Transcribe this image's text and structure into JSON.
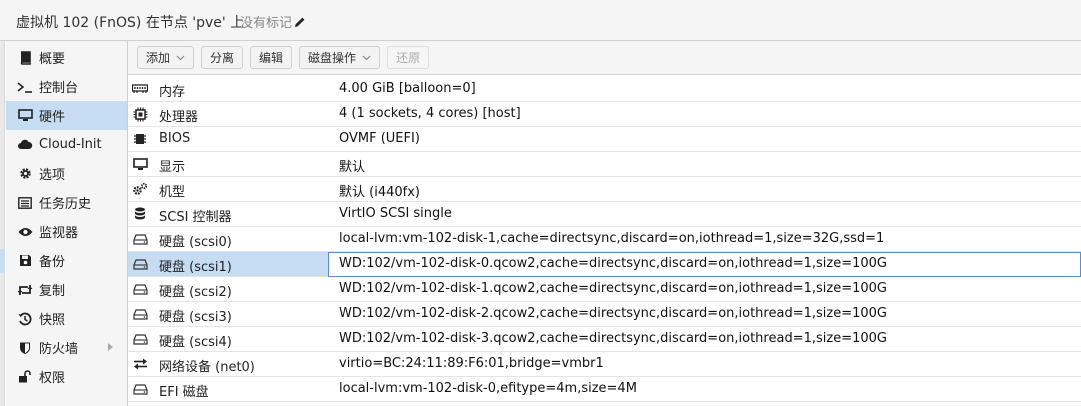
{
  "header": {
    "title": "虚拟机 102 (FnOS) 在节点 'pve' 上",
    "tags": "没有标记"
  },
  "sidebar": {
    "items": [
      {
        "label": "概要",
        "icon": "book-icon"
      },
      {
        "label": "控制台",
        "icon": "terminal-icon"
      },
      {
        "label": "硬件",
        "icon": "monitor-icon",
        "active": true
      },
      {
        "label": "Cloud-Init",
        "icon": "cloud-icon"
      },
      {
        "label": "选项",
        "icon": "gear-icon"
      },
      {
        "label": "任务历史",
        "icon": "list-icon"
      },
      {
        "label": "监视器",
        "icon": "eye-icon"
      },
      {
        "label": "备份",
        "icon": "floppy-icon"
      },
      {
        "label": "复制",
        "icon": "retweet-icon"
      },
      {
        "label": "快照",
        "icon": "history-icon"
      },
      {
        "label": "防火墙",
        "icon": "shield-icon"
      },
      {
        "label": "权限",
        "icon": "unlock-icon"
      }
    ]
  },
  "toolbar": {
    "add_label": "添加",
    "detach_label": "分离",
    "edit_label": "编辑",
    "disk_action_label": "磁盘操作",
    "revert_label": "还原"
  },
  "hardware": {
    "rows": [
      {
        "icon": "memory-icon",
        "name": "内存",
        "value": "4.00 GiB [balloon=0]"
      },
      {
        "icon": "cpu-icon",
        "name": "处理器",
        "value": "4 (1 sockets, 4 cores) [host]"
      },
      {
        "icon": "chip-icon",
        "name": "BIOS",
        "value": "OVMF (UEFI)"
      },
      {
        "icon": "display-icon",
        "name": "显示",
        "value": "默认"
      },
      {
        "icon": "cogs-icon",
        "name": "机型",
        "value": "默认 (i440fx)"
      },
      {
        "icon": "database-icon",
        "name": "SCSI 控制器",
        "value": "VirtIO SCSI single"
      },
      {
        "icon": "hdd-icon",
        "name": "硬盘 (scsi0)",
        "value": "local-lvm:vm-102-disk-1,cache=directsync,discard=on,iothread=1,size=32G,ssd=1"
      },
      {
        "icon": "hdd-icon",
        "name": "硬盘 (scsi1)",
        "value": "WD:102/vm-102-disk-0.qcow2,cache=directsync,discard=on,iothread=1,size=100G",
        "selected": true
      },
      {
        "icon": "hdd-icon",
        "name": "硬盘 (scsi2)",
        "value": "WD:102/vm-102-disk-1.qcow2,cache=directsync,discard=on,iothread=1,size=100G"
      },
      {
        "icon": "hdd-icon",
        "name": "硬盘 (scsi3)",
        "value": "WD:102/vm-102-disk-2.qcow2,cache=directsync,discard=on,iothread=1,size=100G"
      },
      {
        "icon": "hdd-icon",
        "name": "硬盘 (scsi4)",
        "value": "WD:102/vm-102-disk-3.qcow2,cache=directsync,discard=on,iothread=1,size=100G"
      },
      {
        "icon": "exchange-icon",
        "name": "网络设备 (net0)",
        "value": "virtio=BC:24:11:89:F6:01,bridge=vmbr1"
      },
      {
        "icon": "hdd-icon",
        "name": "EFI 磁盘",
        "value": "local-lvm:vm-102-disk-0,efitype=4m,size=4M"
      }
    ]
  }
}
